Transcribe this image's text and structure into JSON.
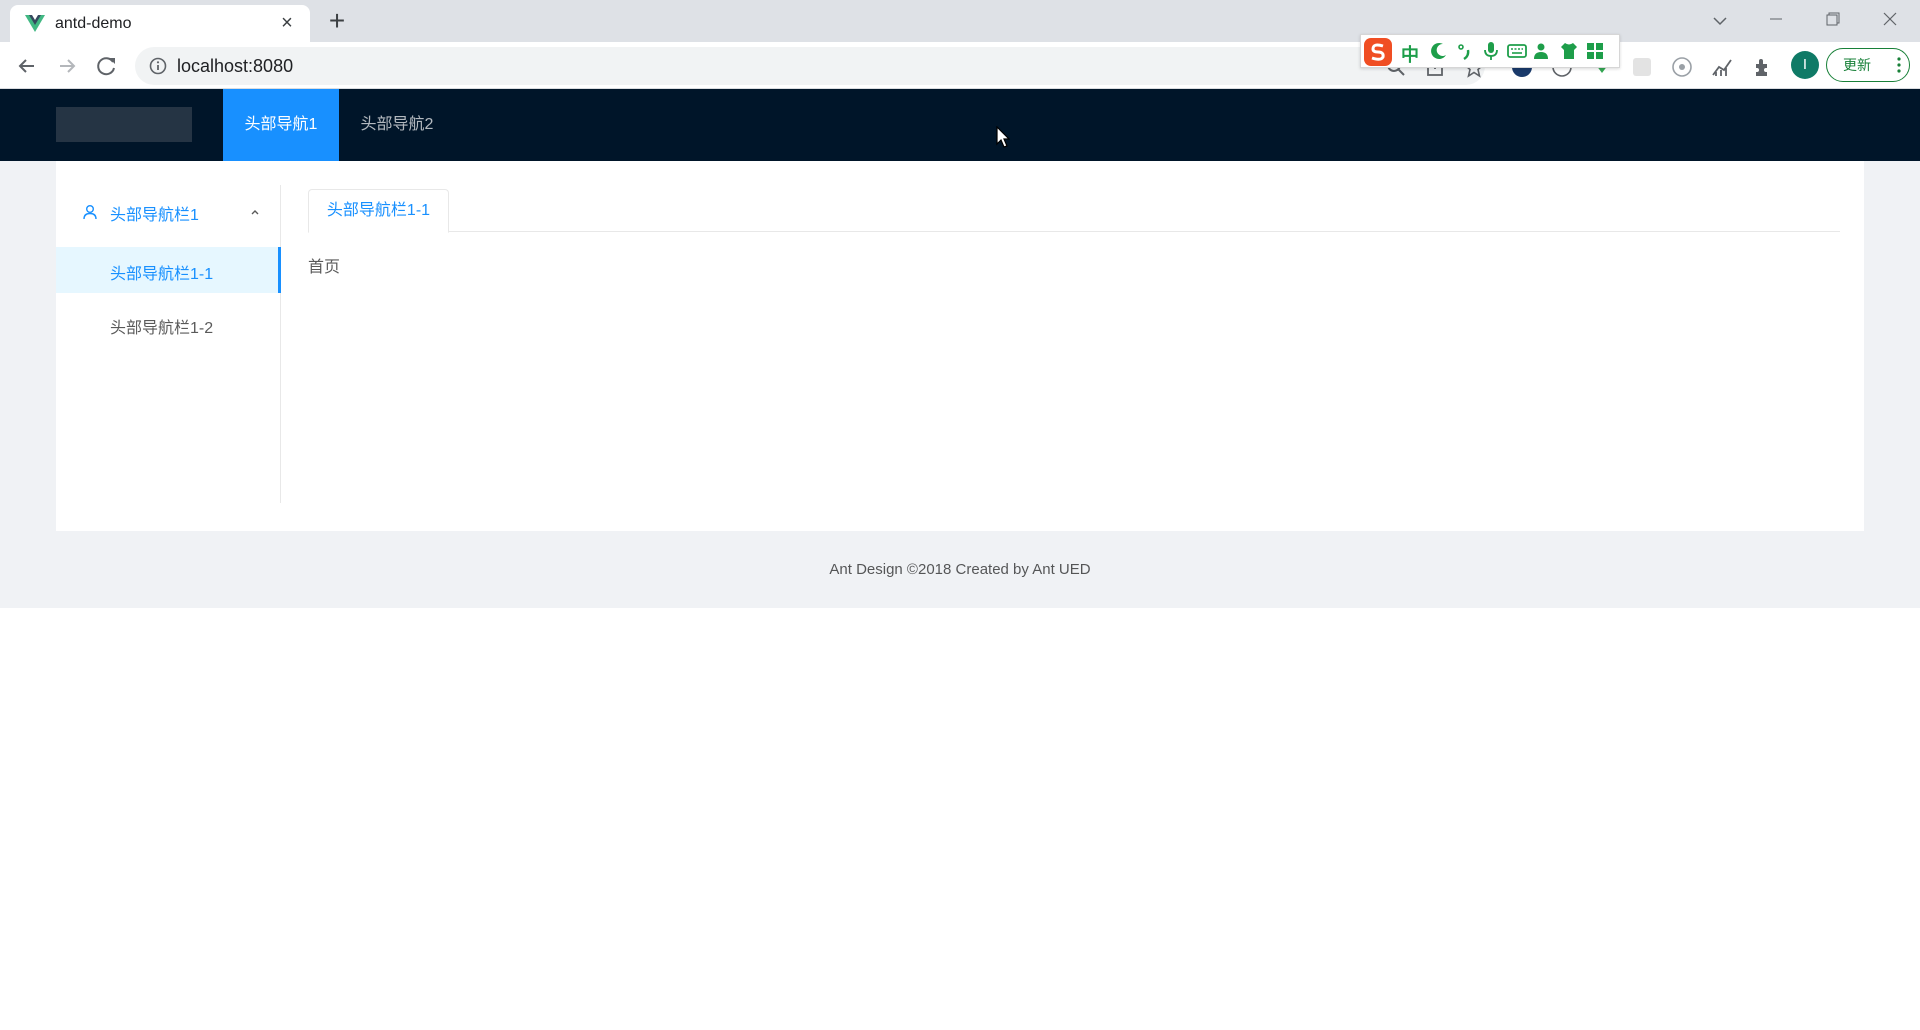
{
  "browser": {
    "tab_title": "antd-demo",
    "url": "localhost:8080",
    "update_button": "更新",
    "profile_initial": "I",
    "ime": {
      "mode_label": "中"
    }
  },
  "app": {
    "header_menu": [
      {
        "label": "头部导航1",
        "selected": true
      },
      {
        "label": "头部导航2",
        "selected": false
      }
    ],
    "sider": {
      "submenu_label": "头部导航栏1",
      "items": [
        {
          "label": "头部导航栏1-1",
          "selected": true
        },
        {
          "label": "头部导航栏1-2",
          "selected": false
        }
      ]
    },
    "tabs": [
      {
        "label": "头部导航栏1-1",
        "active": true
      }
    ],
    "page_text": "首页",
    "footer": "Ant Design ©2018 Created by Ant UED"
  },
  "colors": {
    "primary": "#1890ff",
    "header_bg": "#001529",
    "layout_bg": "#f0f2f5",
    "selected_bg": "#e6f7ff"
  }
}
